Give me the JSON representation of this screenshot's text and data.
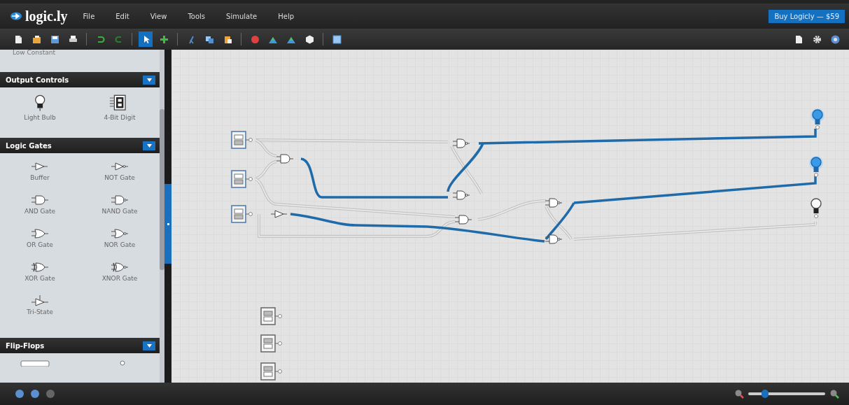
{
  "app": {
    "logo": "logic.ly"
  },
  "menu": [
    "File",
    "Edit",
    "View",
    "Tools",
    "Simulate",
    "Help"
  ],
  "buy_button": "Buy Logicly — $59",
  "toolbar": {
    "tools": [
      {
        "kind": "select",
        "selected": true
      },
      {
        "kind": "add",
        "selected": false
      }
    ]
  },
  "palette": {
    "cut_item": "Low Constant",
    "sections": [
      {
        "title": "Output Controls",
        "expanded": true,
        "items": [
          {
            "label": "Light Bulb",
            "kind": "bulb"
          },
          {
            "label": "4-Bit Digit",
            "kind": "digit"
          }
        ]
      },
      {
        "title": "Logic Gates",
        "expanded": true,
        "items": [
          {
            "label": "Buffer",
            "kind": "buffer"
          },
          {
            "label": "NOT Gate",
            "kind": "not"
          },
          {
            "label": "AND Gate",
            "kind": "and"
          },
          {
            "label": "NAND Gate",
            "kind": "nand"
          },
          {
            "label": "OR Gate",
            "kind": "or"
          },
          {
            "label": "NOR Gate",
            "kind": "nor"
          },
          {
            "label": "XOR Gate",
            "kind": "xor"
          },
          {
            "label": "XNOR Gate",
            "kind": "xnor"
          },
          {
            "label": "Tri-State",
            "kind": "tristate"
          }
        ]
      },
      {
        "title": "Flip-Flops",
        "expanded": true
      }
    ]
  },
  "circuit": {
    "switches": [
      {
        "on": true
      },
      {
        "on": true
      },
      {
        "on": true
      },
      {
        "on": false
      },
      {
        "on": false
      },
      {
        "on": false
      }
    ],
    "bulbs": [
      {
        "lit": true
      },
      {
        "lit": true
      },
      {
        "lit": false
      }
    ]
  },
  "zoom": {
    "level": 0.22
  }
}
